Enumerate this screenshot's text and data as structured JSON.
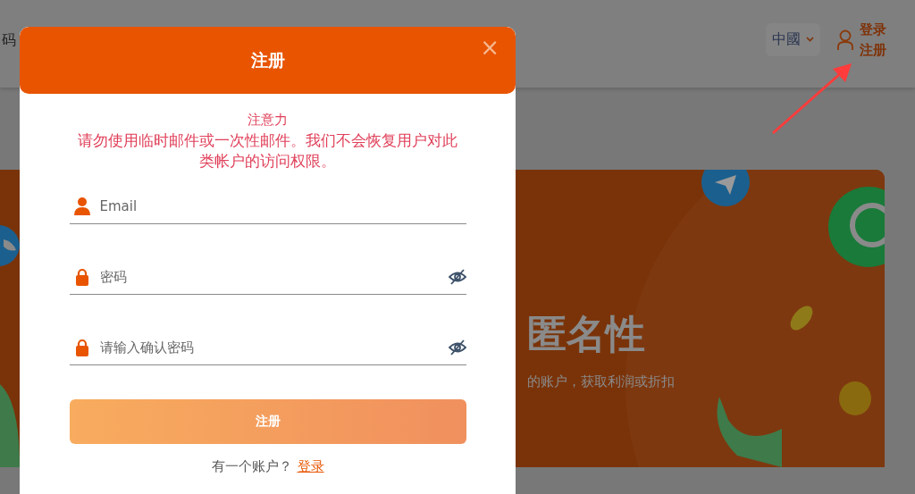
{
  "header": {
    "left_text": "码",
    "language": "中國",
    "login": "登录",
    "register": "注册"
  },
  "page": {
    "banner_title": "匿名性",
    "banner_text": "的账户，获取利润或折扣"
  },
  "modal": {
    "title": "注册",
    "close": "×",
    "notice_title": "注意力",
    "notice_text": "请勿使用临时邮件或一次性邮件。我们不会恢复用户对此类帐户的访问权限。",
    "fields": [
      {
        "kind": "email",
        "placeholder": "Email"
      },
      {
        "kind": "password",
        "placeholder": "密码"
      },
      {
        "kind": "password",
        "placeholder": "请输入确认密码"
      }
    ],
    "submit": "注册",
    "footer_text": "有一个账户？",
    "footer_link": "登录"
  }
}
